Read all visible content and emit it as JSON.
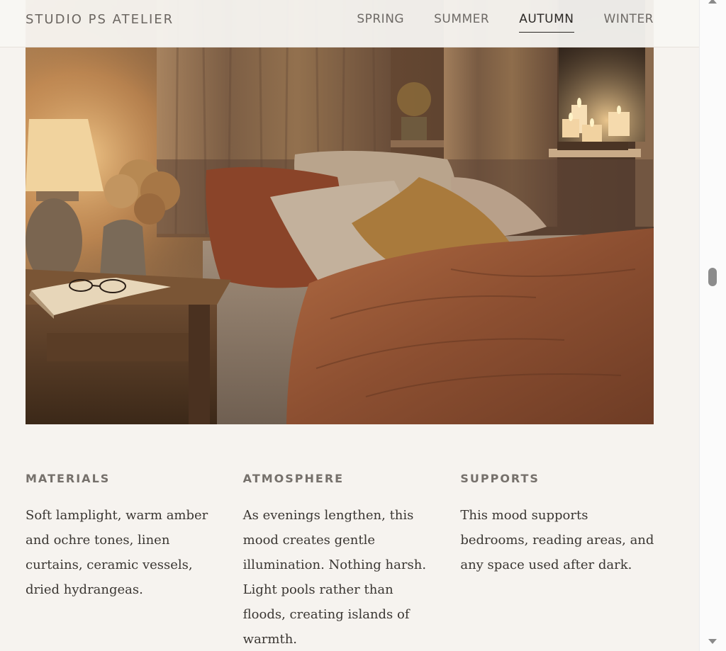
{
  "header": {
    "brand": "STUDIO PS ATELIER",
    "nav": [
      {
        "label": "SPRING",
        "active": false
      },
      {
        "label": "SUMMER",
        "active": false
      },
      {
        "label": "AUTUMN",
        "active": true
      },
      {
        "label": "WINTER",
        "active": false
      }
    ]
  },
  "hero": {
    "icon": "cozy-bedroom-photo"
  },
  "columns": [
    {
      "title": "MATERIALS",
      "body": "Soft lamplight, warm amber and ochre tones, linen curtains, ceramic vessels, dried hydrangeas."
    },
    {
      "title": "ATMOSPHERE",
      "body": "As evenings lengthen, this mood creates gentle illumination. Nothing harsh. Light pools rather than floods, creating islands of warmth."
    },
    {
      "title": "SUPPORTS",
      "body": "This mood supports bedrooms, reading areas, and any space used after dark."
    }
  ],
  "colors": {
    "background": "#f6f3ef",
    "text": "#3a3632",
    "accent": "#2b2825"
  }
}
